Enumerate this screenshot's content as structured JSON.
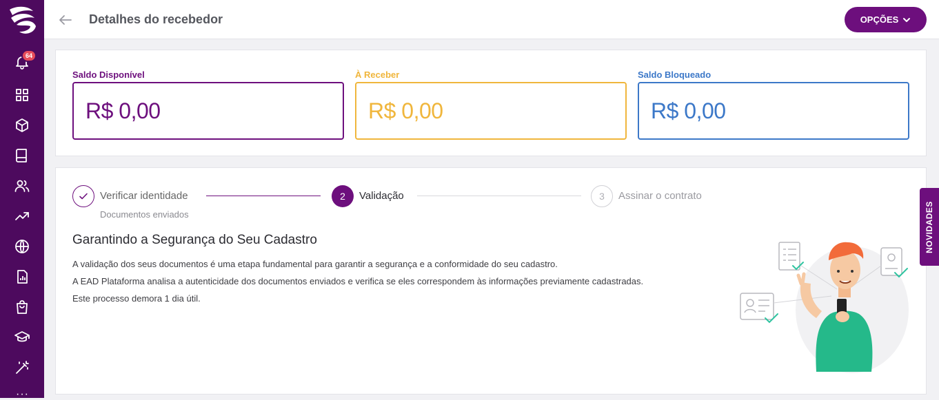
{
  "sidebar": {
    "notification_count": "64",
    "items": [
      {
        "name": "bell-icon"
      },
      {
        "name": "dashboard-icon"
      },
      {
        "name": "box-icon"
      },
      {
        "name": "book-icon"
      },
      {
        "name": "users-icon"
      },
      {
        "name": "trending-up-icon"
      },
      {
        "name": "globe-icon"
      },
      {
        "name": "report-icon"
      },
      {
        "name": "shopping-bag-icon"
      },
      {
        "name": "graduation-cap-icon"
      },
      {
        "name": "magic-wand-icon"
      }
    ],
    "more_label": "···"
  },
  "header": {
    "title": "Detalhes do recebedor",
    "options_label": "OPÇÕES"
  },
  "balances": [
    {
      "label": "Saldo Disponível",
      "value": "R$ 0,00",
      "color": "#6d0f7d"
    },
    {
      "label": "À Receber",
      "value": "R$ 0,00",
      "color": "#f0b63c"
    },
    {
      "label": "Saldo Bloqueado",
      "value": "R$ 0,00",
      "color": "#3c78c8"
    }
  ],
  "steps": [
    {
      "label": "Verificar identidade",
      "sub": "Documentos enviados",
      "state": "done"
    },
    {
      "number": "2",
      "label": "Validação",
      "state": "active"
    },
    {
      "number": "3",
      "label": "Assinar o contrato",
      "state": "pending"
    }
  ],
  "content": {
    "title": "Garantindo a Segurança do Seu Cadastro",
    "paragraphs": [
      "A validação dos seus documentos é uma etapa fundamental para garantir a segurança e a conformidade do seu cadastro.",
      "A EAD Plataforma analisa a autenticidade dos documentos enviados e verifica se eles correspondem às informações previamente cadastradas.",
      "Este processo demora 1 dia útil."
    ]
  },
  "novidades_label": "NOVIDADES",
  "colors": {
    "brand": "#6d0f7d",
    "sidebar": "#4d0a5e",
    "badge": "#e74c5a",
    "success": "#2ec4a0"
  }
}
